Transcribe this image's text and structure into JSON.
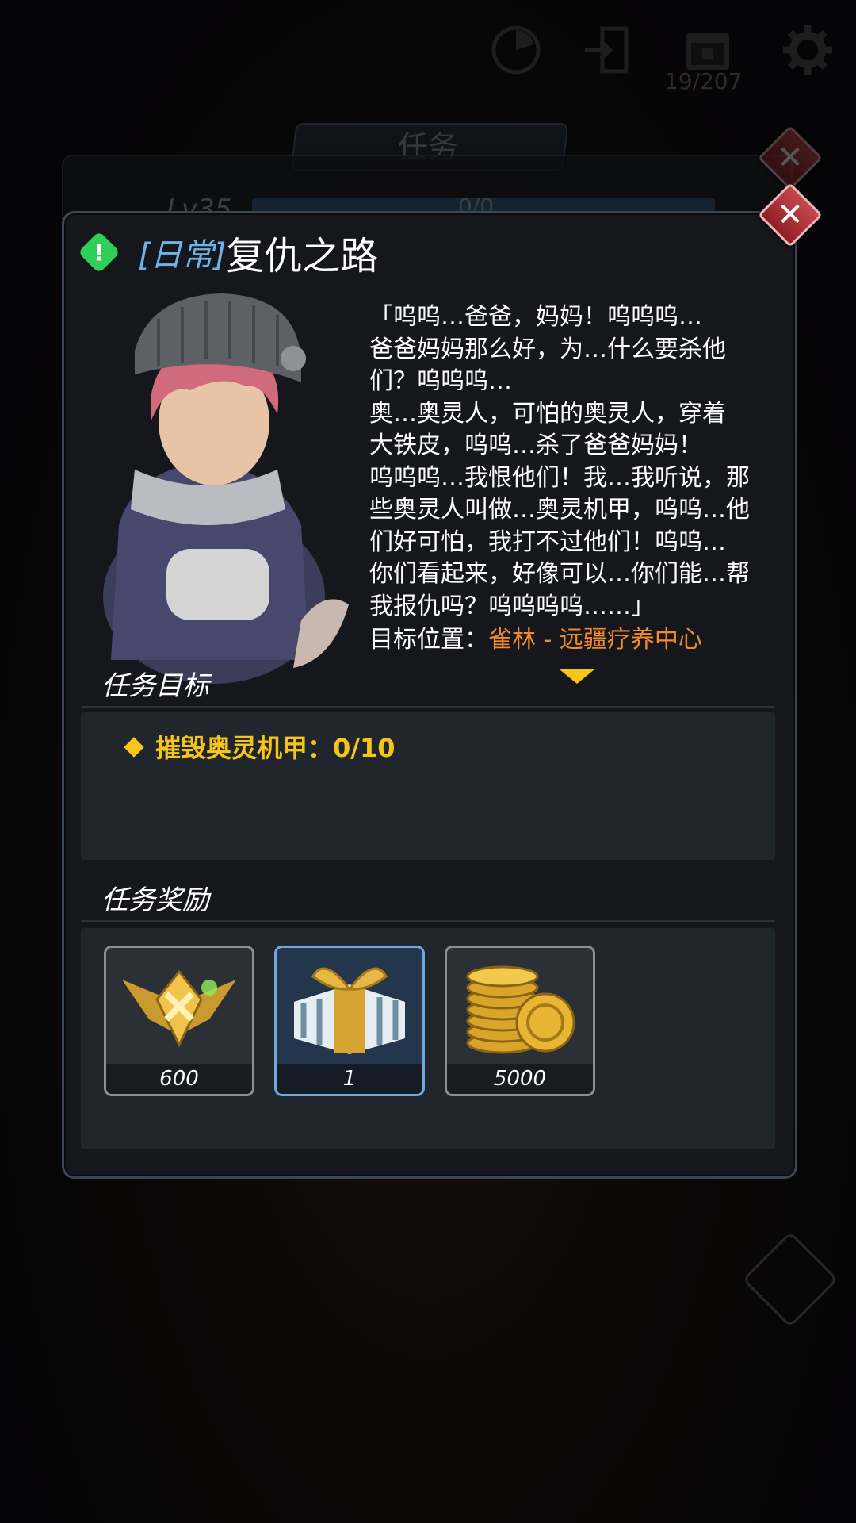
{
  "top_bar": {
    "counter": "19/207",
    "icons": [
      "radar-icon",
      "exit-icon",
      "calendar-icon",
      "gear-icon"
    ]
  },
  "back_panel": {
    "title": "任务",
    "level": "Lv35",
    "progress": "0/0"
  },
  "dialog": {
    "tag": "[日常]",
    "title": "复仇之路",
    "story": "「呜呜…爸爸，妈妈！呜呜呜…\n爸爸妈妈那么好，为…什么要杀他\n们？呜呜呜…\n奥…奥灵人，可怕的奥灵人，穿着\n大铁皮，呜呜…杀了爸爸妈妈！\n呜呜呜…我恨他们！我…我听说，那\n些奥灵人叫做…奥灵机甲，呜呜…他\n们好可怕，我打不过他们！呜呜…\n你们看起来，好像可以…你们能…帮\n我报仇吗？呜呜呜呜……」",
    "target_label": "目标位置：",
    "target_value": "雀林 - 远疆疗养中心",
    "objectives_header": "任务目标",
    "objective": "摧毁奥灵机甲：0/10",
    "rewards_header": "任务奖励",
    "rewards": [
      {
        "name": "emblem-icon",
        "qty": "600"
      },
      {
        "name": "gift-box-icon",
        "qty": "1"
      },
      {
        "name": "gold-coins-icon",
        "qty": "5000"
      }
    ]
  },
  "colors": {
    "accent_yellow": "#f5c518",
    "target_orange": "#f08a2c",
    "tag_blue": "#6fb2e6",
    "alert_green": "#2fcf58",
    "close_red": "#c7484e"
  }
}
